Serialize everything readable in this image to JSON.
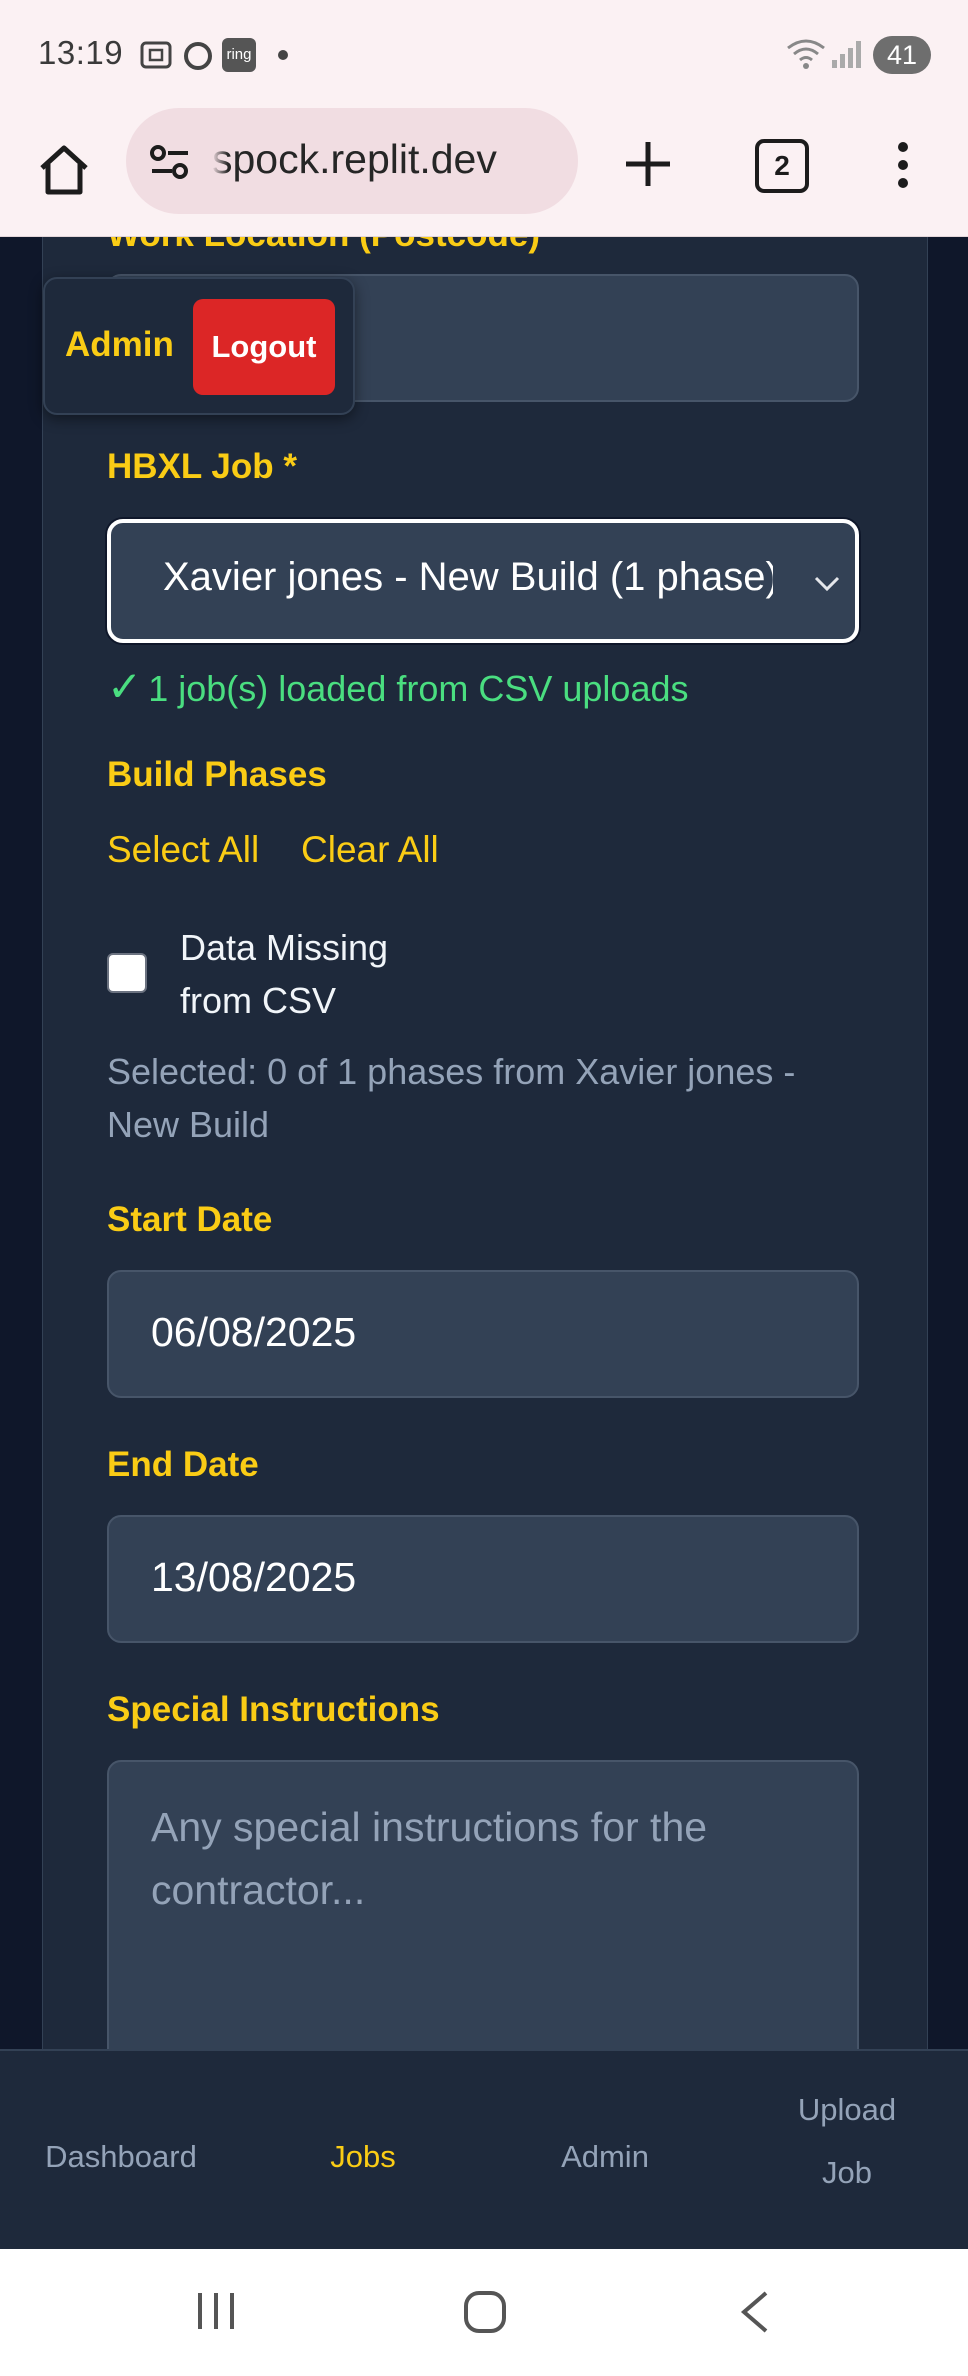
{
  "status_bar": {
    "time": "13:19",
    "notification_icons": [
      "screenshot-icon",
      "circle-app-icon",
      "ring-app-icon",
      "dot-icon"
    ],
    "ring_label": "ring",
    "battery": "41"
  },
  "browser": {
    "url": "spock.replit.dev",
    "tab_count": "2"
  },
  "admin_bar": {
    "role_label": "Admin",
    "logout_label": "Logout"
  },
  "form": {
    "cut_label": "Work Location (Postcode)",
    "hbxl_job": {
      "label": "HBXL Job *",
      "selected_value": "Xavier jones - New Build (1 phase)",
      "success_check": "✓",
      "success_text": "1 job(s) loaded from CSV uploads"
    },
    "build_phases": {
      "label": "Build Phases",
      "select_all": "Select All",
      "clear_all": "Clear All",
      "phases": [
        {
          "label": "Data Missing from CSV",
          "checked": false
        }
      ],
      "selected_summary": "Selected: 0 of 1 phases from Xavier jones - New Build"
    },
    "start_date": {
      "label": "Start Date",
      "value": "06/08/2025"
    },
    "end_date": {
      "label": "End Date",
      "value": "13/08/2025"
    },
    "special_instructions": {
      "label": "Special Instructions",
      "placeholder": "Any special instructions for the contractor..."
    }
  },
  "bottom_nav": {
    "items": [
      {
        "label": "Dashboard",
        "active": false
      },
      {
        "label": "Jobs",
        "active": true
      },
      {
        "label": "Admin",
        "active": false
      },
      {
        "label": "Upload Job",
        "active": false
      }
    ]
  },
  "colors": {
    "accent": "#facc15",
    "success": "#4ade80",
    "danger": "#dc2626",
    "card_bg": "#1e293b",
    "field_bg": "#334155"
  }
}
